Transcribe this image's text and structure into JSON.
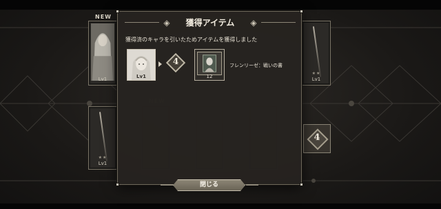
{
  "dialog": {
    "title": "獲得アイテム",
    "message": "獲得済のキャラを引いたためアイテムを獲得しました",
    "character": {
      "level_label": "Lv1"
    },
    "limit_break_value": "4",
    "item": {
      "count": "12",
      "name": "フレンリーゼ：戦いの書"
    },
    "close_label": "閉じる"
  },
  "background": {
    "new_tag": "NEW",
    "cards": [
      {
        "level_label": "Lv1"
      },
      {
        "level_label": "Lv1",
        "stars": "★★"
      },
      {
        "level_label": "Lv1",
        "stars": "★★"
      }
    ],
    "limit_badge_value": "4"
  },
  "colors": {
    "dialog_bg": "#262320",
    "border": "#6e685b",
    "button": "#7a7466",
    "text": "#e8e2d6"
  }
}
